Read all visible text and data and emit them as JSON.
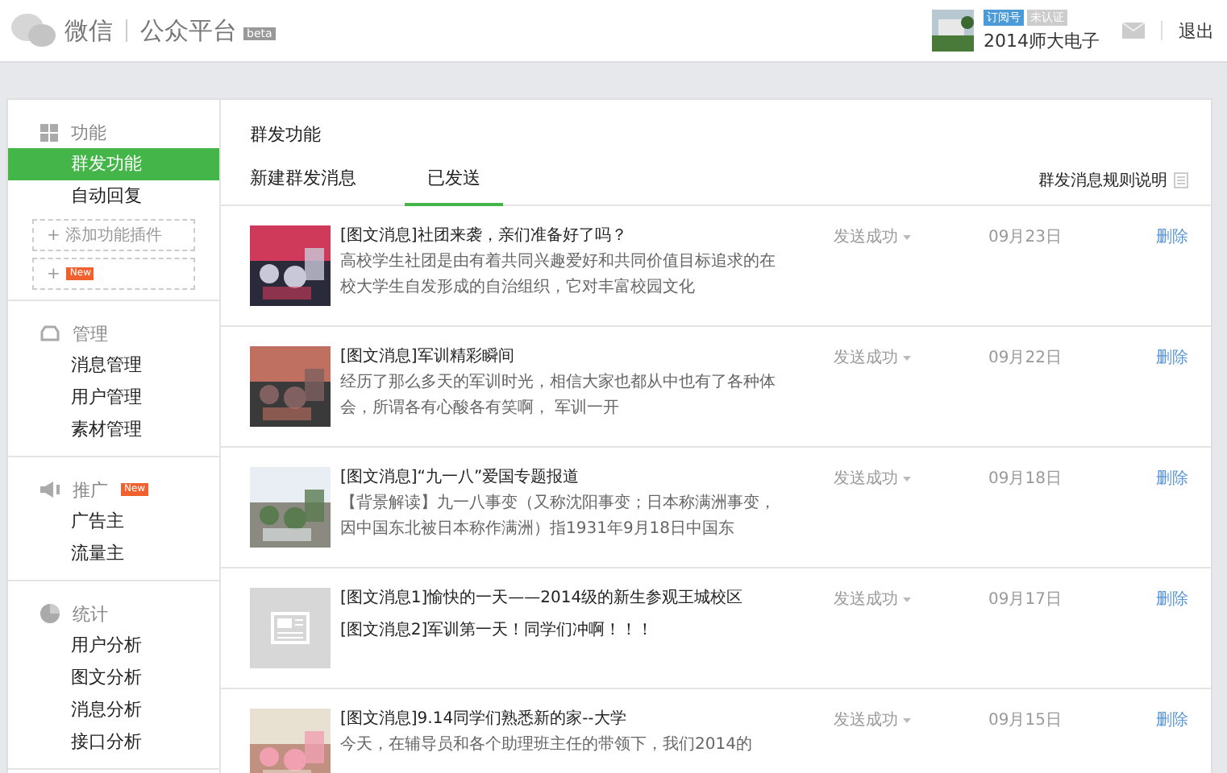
{
  "header": {
    "logo_text": "微信",
    "platform": "公众平台",
    "beta": "beta",
    "account_type": "订阅号",
    "verify": "未认证",
    "account_name": "2014师大电子",
    "logout": "退出"
  },
  "sidebar": {
    "sections": [
      {
        "title": "功能",
        "items": [
          {
            "label": "群发功能",
            "selected": true
          },
          {
            "label": "自动回复",
            "selected": false
          }
        ],
        "plugins": [
          {
            "label": "+ 添加功能插件"
          },
          {
            "label": "+",
            "tag": "New"
          }
        ]
      },
      {
        "title": "管理",
        "items": [
          {
            "label": "消息管理",
            "selected": false
          },
          {
            "label": "用户管理",
            "selected": false
          },
          {
            "label": "素材管理",
            "selected": false
          }
        ]
      },
      {
        "title": "推广",
        "tag": "New",
        "items": [
          {
            "label": "广告主",
            "selected": false
          },
          {
            "label": "流量主",
            "selected": false
          }
        ]
      },
      {
        "title": "统计",
        "items": [
          {
            "label": "用户分析",
            "selected": false
          },
          {
            "label": "图文分析",
            "selected": false
          },
          {
            "label": "消息分析",
            "selected": false
          },
          {
            "label": "接口分析",
            "selected": false
          }
        ]
      }
    ]
  },
  "main": {
    "title": "群发功能",
    "tabs": [
      {
        "label": "新建群发消息",
        "selected": false
      },
      {
        "label": "已发送",
        "selected": true
      }
    ],
    "rules_link": "群发消息规则说明",
    "messages": [
      {
        "kind": "single",
        "title": "[图文消息]社团来袭，亲们准备好了吗？",
        "desc": "高校学生社团是由有着共同兴趣爱好和共同价值目标追求的在校大学生自发形成的自治组织，它对丰富校园文化",
        "status": "发送成功",
        "date": "09月23日",
        "action": "删除"
      },
      {
        "kind": "single",
        "title": "[图文消息]军训精彩瞬间",
        "desc": "经历了那么多天的军训时光，相信大家也都从中也有了各种体会，所谓各有心酸各有笑啊， 军训一开",
        "status": "发送成功",
        "date": "09月22日",
        "action": "删除"
      },
      {
        "kind": "single",
        "title": "[图文消息]“九一八”爱国专题报道",
        "desc": "【背景解读】九一八事变（又称沈阳事变；日本称满洲事变，因中国东北被日本称作满洲）指1931年9月18日中国东",
        "status": "发送成功",
        "date": "09月18日",
        "action": "删除"
      },
      {
        "kind": "multi",
        "title": "[图文消息1]愉快的一天——2014级的新生参观王城校区",
        "desc": "[图文消息2]军训第一天！同学们冲啊！！！",
        "status": "发送成功",
        "date": "09月17日",
        "action": "删除"
      },
      {
        "kind": "single",
        "title": "[图文消息]9.14同学们熟悉新的家--大学",
        "desc": "今天，在辅导员和各个助理班主任的带领下，我们2014的",
        "status": "发送成功",
        "date": "09月15日",
        "action": "删除"
      }
    ]
  }
}
